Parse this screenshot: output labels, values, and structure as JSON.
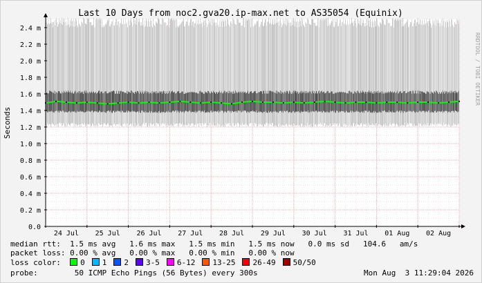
{
  "chart_data": {
    "type": "line",
    "title": "Last 10 Days from noc2.gva20.ip-max.net to AS35054 (Equinix)",
    "ylabel": "Seconds",
    "watermark": "RRDTOOL / TOBI OETIKER",
    "ylim": [
      0,
      0.0025
    ],
    "yticks": [
      {
        "value": 0.0,
        "label": "0.0"
      },
      {
        "value": 0.0002,
        "label": "0.2 m"
      },
      {
        "value": 0.0004,
        "label": "0.4 m"
      },
      {
        "value": 0.0006,
        "label": "0.6 m"
      },
      {
        "value": 0.0008,
        "label": "0.8 m"
      },
      {
        "value": 0.001,
        "label": "1.0 m"
      },
      {
        "value": 0.0012,
        "label": "1.2 m"
      },
      {
        "value": 0.0014,
        "label": "1.4 m"
      },
      {
        "value": 0.0016,
        "label": "1.6 m"
      },
      {
        "value": 0.0018,
        "label": "1.8 m"
      },
      {
        "value": 0.002,
        "label": "2.0 m"
      },
      {
        "value": 0.0022,
        "label": "2.2 m"
      },
      {
        "value": 0.0024,
        "label": "2.4 m"
      }
    ],
    "xticks": [
      "24 Jul",
      "25 Jul",
      "26 Jul",
      "27 Jul",
      "28 Jul",
      "29 Jul",
      "30 Jul",
      "31 Jul",
      "01 Aug",
      "02 Aug"
    ],
    "x_days": 10,
    "series": [
      {
        "name": "median rtt",
        "color": "#00ff00",
        "x": [
          0,
          0.25,
          0.5,
          0.75,
          1,
          1.25,
          1.5,
          1.75,
          2,
          2.25,
          2.5,
          2.75,
          3,
          3.25,
          3.5,
          3.75,
          4,
          4.25,
          4.5,
          4.75,
          5,
          5.25,
          5.5,
          5.75,
          6,
          6.25,
          6.5,
          6.75,
          7,
          7.25,
          7.5,
          7.75,
          8,
          8.25,
          8.5,
          8.75,
          9,
          9.25,
          9.5,
          9.75,
          10
        ],
        "values": [
          0.00149,
          0.00151,
          0.0015,
          0.00149,
          0.0015,
          0.00149,
          0.00148,
          0.00149,
          0.0015,
          0.00149,
          0.0015,
          0.00149,
          0.0015,
          0.00151,
          0.0015,
          0.00149,
          0.0015,
          0.00149,
          0.00148,
          0.0015,
          0.00151,
          0.0015,
          0.0015,
          0.00149,
          0.0015,
          0.00149,
          0.0015,
          0.00151,
          0.0015,
          0.00149,
          0.0015,
          0.0015,
          0.00149,
          0.0015,
          0.0015,
          0.00149,
          0.0015,
          0.0015,
          0.00149,
          0.0015,
          0.00151
        ]
      }
    ],
    "smoke": {
      "min_low": 0.00125,
      "max_high": 0.00252,
      "dense_low": 0.0014,
      "dense_high": 0.0016
    }
  },
  "stats": {
    "median_label": "median rtt:",
    "median_values": "1.5 ms avg   1.6 ms max   1.5 ms min   1.5 ms now   0.0 ms sd   104.6   am/s",
    "loss_label": "packet loss:",
    "loss_values": "0.00 % avg   0.00 % max   0.00 % min   0.00 % now"
  },
  "loss_color": {
    "label": "loss color:",
    "items": [
      {
        "label": "0",
        "color": "#00ff00"
      },
      {
        "label": "1",
        "color": "#00b8ff"
      },
      {
        "label": "2",
        "color": "#0059ff"
      },
      {
        "label": "3-5",
        "color": "#5e00ff"
      },
      {
        "label": "6-12",
        "color": "#ff00ff"
      },
      {
        "label": "13-25",
        "color": "#ff5500"
      },
      {
        "label": "26-49",
        "color": "#ff0000"
      },
      {
        "label": "50/50",
        "color": "#a10000"
      }
    ]
  },
  "probe": {
    "label": "probe:",
    "text": "50 ICMP Echo Pings (56 Bytes) every 300s",
    "timestamp": "Mon Aug  3 11:29:04 2026"
  }
}
